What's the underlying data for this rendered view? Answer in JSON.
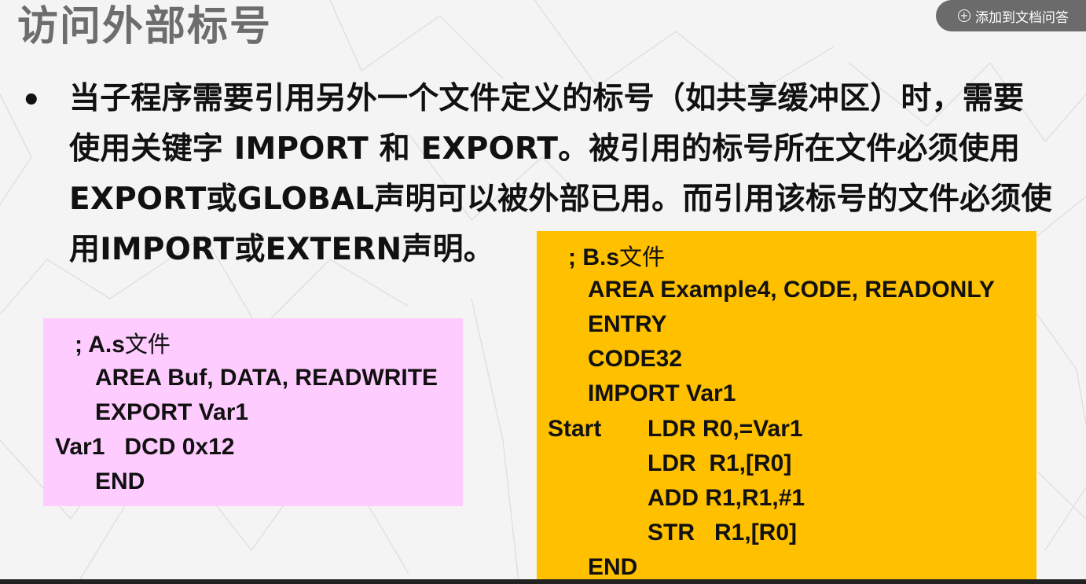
{
  "title": "访问外部标号",
  "add_button": {
    "label": "添加到文档问答"
  },
  "bullet": "•",
  "paragraph_lines": [
    "当子程序需要引用另外一个文件定义的标号（如共享缓冲区）时，需要",
    "使用关键字 IMPORT 和 EXPORT。被引用的标号所在文件必须使用",
    "EXPORT或GLOBAL声明可以被外部已用。而引用该标号的文件必须使",
    "用IMPORT或EXTERN声明。"
  ],
  "file_a": {
    "header_prefix": "; A.s",
    "header_suffix": "文件",
    "lines": [
      "AREA Buf, DATA, READWRITE",
      "EXPORT Var1",
      "Var1   DCD 0x12",
      "END"
    ]
  },
  "file_b": {
    "header_prefix": "; B.s",
    "header_suffix": "文件",
    "lines": [
      "AREA Example4, CODE, READONLY",
      "ENTRY",
      "CODE32",
      "IMPORT Var1",
      "LDR R0,=Var1",
      "LDR  R1,[R0]",
      "ADD R1,R1,#1",
      "STR   R1,[R0]",
      "END"
    ],
    "label_start": "Start"
  },
  "colors": {
    "background": "#f4f4f4",
    "title": "#6d6d6d",
    "box_a": "#ffccff",
    "box_b": "#ffc000",
    "button": "#6b6b6b"
  },
  "icons": {
    "add": "plus-circle-icon"
  }
}
